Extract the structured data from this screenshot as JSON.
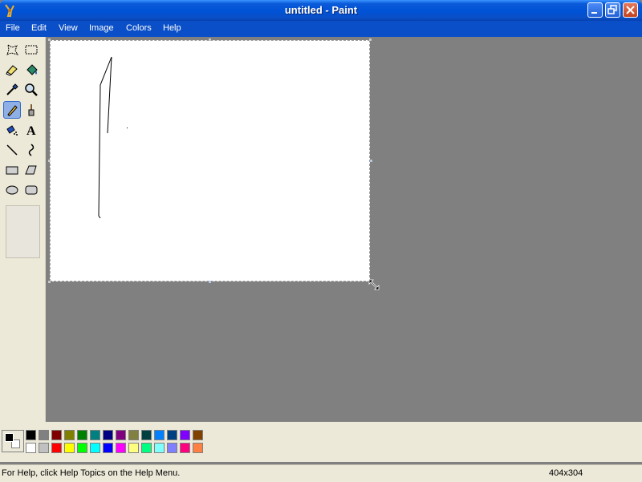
{
  "window": {
    "title": "untitled - Paint"
  },
  "menu": {
    "items": [
      "File",
      "Edit",
      "View",
      "Image",
      "Colors",
      "Help"
    ]
  },
  "tools": [
    {
      "name": "free-form-select-icon"
    },
    {
      "name": "select-icon"
    },
    {
      "name": "eraser-icon"
    },
    {
      "name": "fill-bucket-icon"
    },
    {
      "name": "pick-color-icon"
    },
    {
      "name": "magnifier-icon"
    },
    {
      "name": "pencil-icon",
      "selected": true
    },
    {
      "name": "brush-icon"
    },
    {
      "name": "airbrush-icon"
    },
    {
      "name": "text-icon"
    },
    {
      "name": "line-icon"
    },
    {
      "name": "curve-icon"
    },
    {
      "name": "rectangle-icon"
    },
    {
      "name": "polygon-icon"
    },
    {
      "name": "ellipse-icon"
    },
    {
      "name": "rounded-rectangle-icon"
    }
  ],
  "palette": {
    "foreground": "#000000",
    "background": "#ffffff",
    "colors_top": [
      "#000000",
      "#808080",
      "#800000",
      "#808000",
      "#008000",
      "#008080",
      "#000080",
      "#800080",
      "#808040",
      "#004040",
      "#0080ff",
      "#004080",
      "#8000ff",
      "#804000"
    ],
    "colors_bottom": [
      "#ffffff",
      "#c0c0c0",
      "#ff0000",
      "#ffff00",
      "#00ff00",
      "#00ffff",
      "#0000ff",
      "#ff00ff",
      "#ffff80",
      "#00ff80",
      "#80ffff",
      "#8080ff",
      "#ff0080",
      "#ff8040"
    ]
  },
  "status": {
    "help_text": "For Help, click Help Topics on the Help Menu.",
    "canvas_size": "404x304"
  }
}
